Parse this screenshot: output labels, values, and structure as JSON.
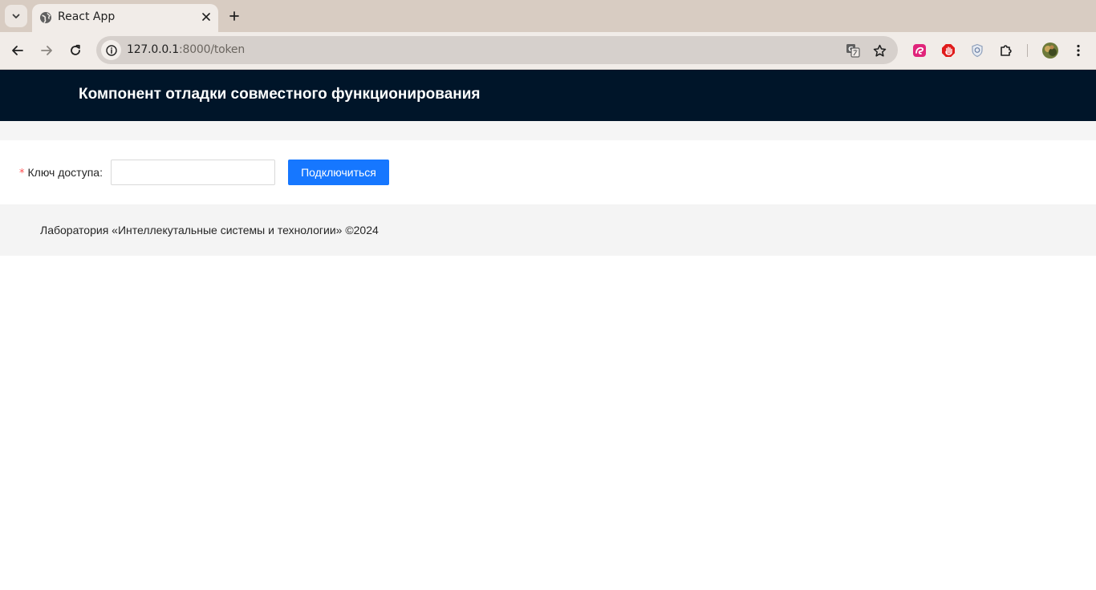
{
  "browser": {
    "tab": {
      "title": "React App"
    },
    "address": {
      "host": "127.0.0.1",
      "rest": ":8000/token"
    },
    "icons": {
      "tab_search": "chevron-down-icon",
      "favicon": "globe-icon",
      "close": "close-icon",
      "new_tab": "plus-icon",
      "back": "arrow-left-icon",
      "forward": "arrow-right-icon",
      "reload": "reload-icon",
      "info": "info-icon",
      "translate": "translate-icon",
      "bookmark": "star-icon",
      "extensions": "puzzle-icon",
      "menu": "kebab-menu-icon"
    }
  },
  "header": {
    "title": "Компонент отладки совместного функционирования"
  },
  "form": {
    "required_mark": "*",
    "label": "Ключ доступа",
    "input_value": "",
    "input_placeholder": "",
    "submit_label": "Подключиться"
  },
  "footer": {
    "text": "Лаборатория «Интеллекутальные системы и технологии» ©2024"
  },
  "colors": {
    "header_bg": "#001529",
    "primary": "#1677ff",
    "required": "#ff4d4f",
    "footer_bg": "#f4f4f4"
  }
}
